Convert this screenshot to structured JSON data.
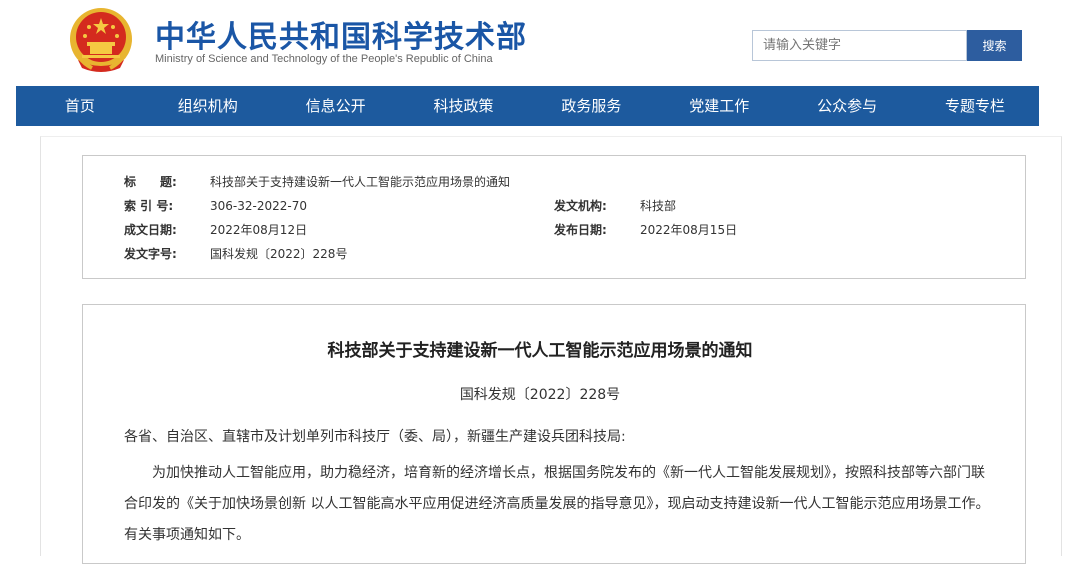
{
  "header": {
    "site_title": "中华人民共和国科学技术部",
    "site_subtitle": "Ministry of Science and Technology of the People's Republic of China",
    "search_placeholder": "请输入关键字",
    "search_button": "搜索",
    "emblem_icon": "national-emblem-icon"
  },
  "nav": {
    "items": [
      "首页",
      "组织机构",
      "信息公开",
      "科技政策",
      "政务服务",
      "党建工作",
      "公众参与",
      "专题专栏"
    ]
  },
  "meta": {
    "title_label": "标　　题:",
    "title_value": "科技部关于支持建设新一代人工智能示范应用场景的通知",
    "index_label": "索 引 号:",
    "index_value": "306-32-2022-70",
    "issuer_label": "发文机构:",
    "issuer_value": "科技部",
    "created_label": "成文日期:",
    "created_value": "2022年08月12日",
    "published_label": "发布日期:",
    "published_value": "2022年08月15日",
    "docno_label": "发文字号:",
    "docno_value": "国科发规〔2022〕228号"
  },
  "document": {
    "title": "科技部关于支持建设新一代人工智能示范应用场景的通知",
    "number": "国科发规〔2022〕228号",
    "salutation": "各省、自治区、直辖市及计划单列市科技厅（委、局），新疆生产建设兵团科技局:",
    "para1_line1": "为加快推动人工智能应用，助力稳经济，培育新的经济增长点，根据国务院发布的《新一代人工智能发展规划》，按照科技部等六部门联",
    "para1_line2": "合印发的《关于加快场景创新 以人工智能高水平应用促进经济高质量发展的指导意见》，现启动支持建设新一代人工智能示范应用场景工作。",
    "para1_line3": "有关事项通知如下。"
  },
  "colors": {
    "brand_blue": "#1a56a6",
    "nav_blue": "#1d5a9e",
    "search_button_blue": "#2d5d9f",
    "emblem_red": "#d42a1e",
    "emblem_gold": "#e8b530"
  }
}
